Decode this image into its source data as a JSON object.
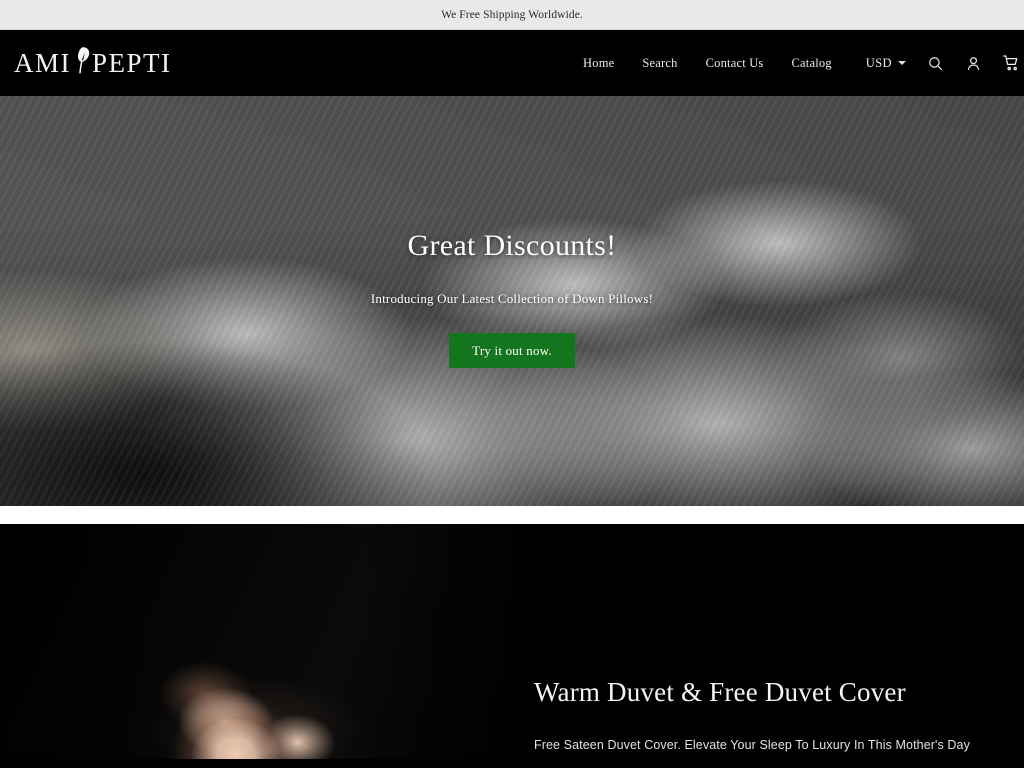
{
  "announcement": {
    "text": "We Free Shipping Worldwide."
  },
  "header": {
    "brand": {
      "word_left": "AMI",
      "word_right": "PEPTI",
      "mark_icon": "feather-quill-icon"
    },
    "nav": [
      {
        "label": "Home"
      },
      {
        "label": "Search"
      },
      {
        "label": "Contact Us"
      },
      {
        "label": "Catalog"
      }
    ],
    "currency": {
      "selected": "USD",
      "caret_icon": "chevron-down-icon"
    },
    "icons": [
      {
        "name": "search-icon",
        "label": "Search"
      },
      {
        "name": "account-icon",
        "label": "Account"
      },
      {
        "name": "cart-icon",
        "label": "Cart"
      }
    ]
  },
  "hero": {
    "heading": "Great Discounts!",
    "subheading": "Introducing Our Latest Collection of Down Pillows!",
    "cta_label": "Try it out now.",
    "cta_color": "#14751f",
    "image_alt": "white down pillows and duvet stacked on a bed"
  },
  "feature": {
    "heading": "Warm Duvet & Free Duvet Cover",
    "body": "Free Sateen Duvet Cover. Elevate Your Sleep To Luxury In This Mother's Day",
    "image_alt": "woman with eyes closed resting in dim warm light"
  },
  "colors": {
    "announcement_bg": "#e9e9e9",
    "header_bg": "#000000",
    "accent_green": "#14751f",
    "text_light": "#ffffff"
  }
}
